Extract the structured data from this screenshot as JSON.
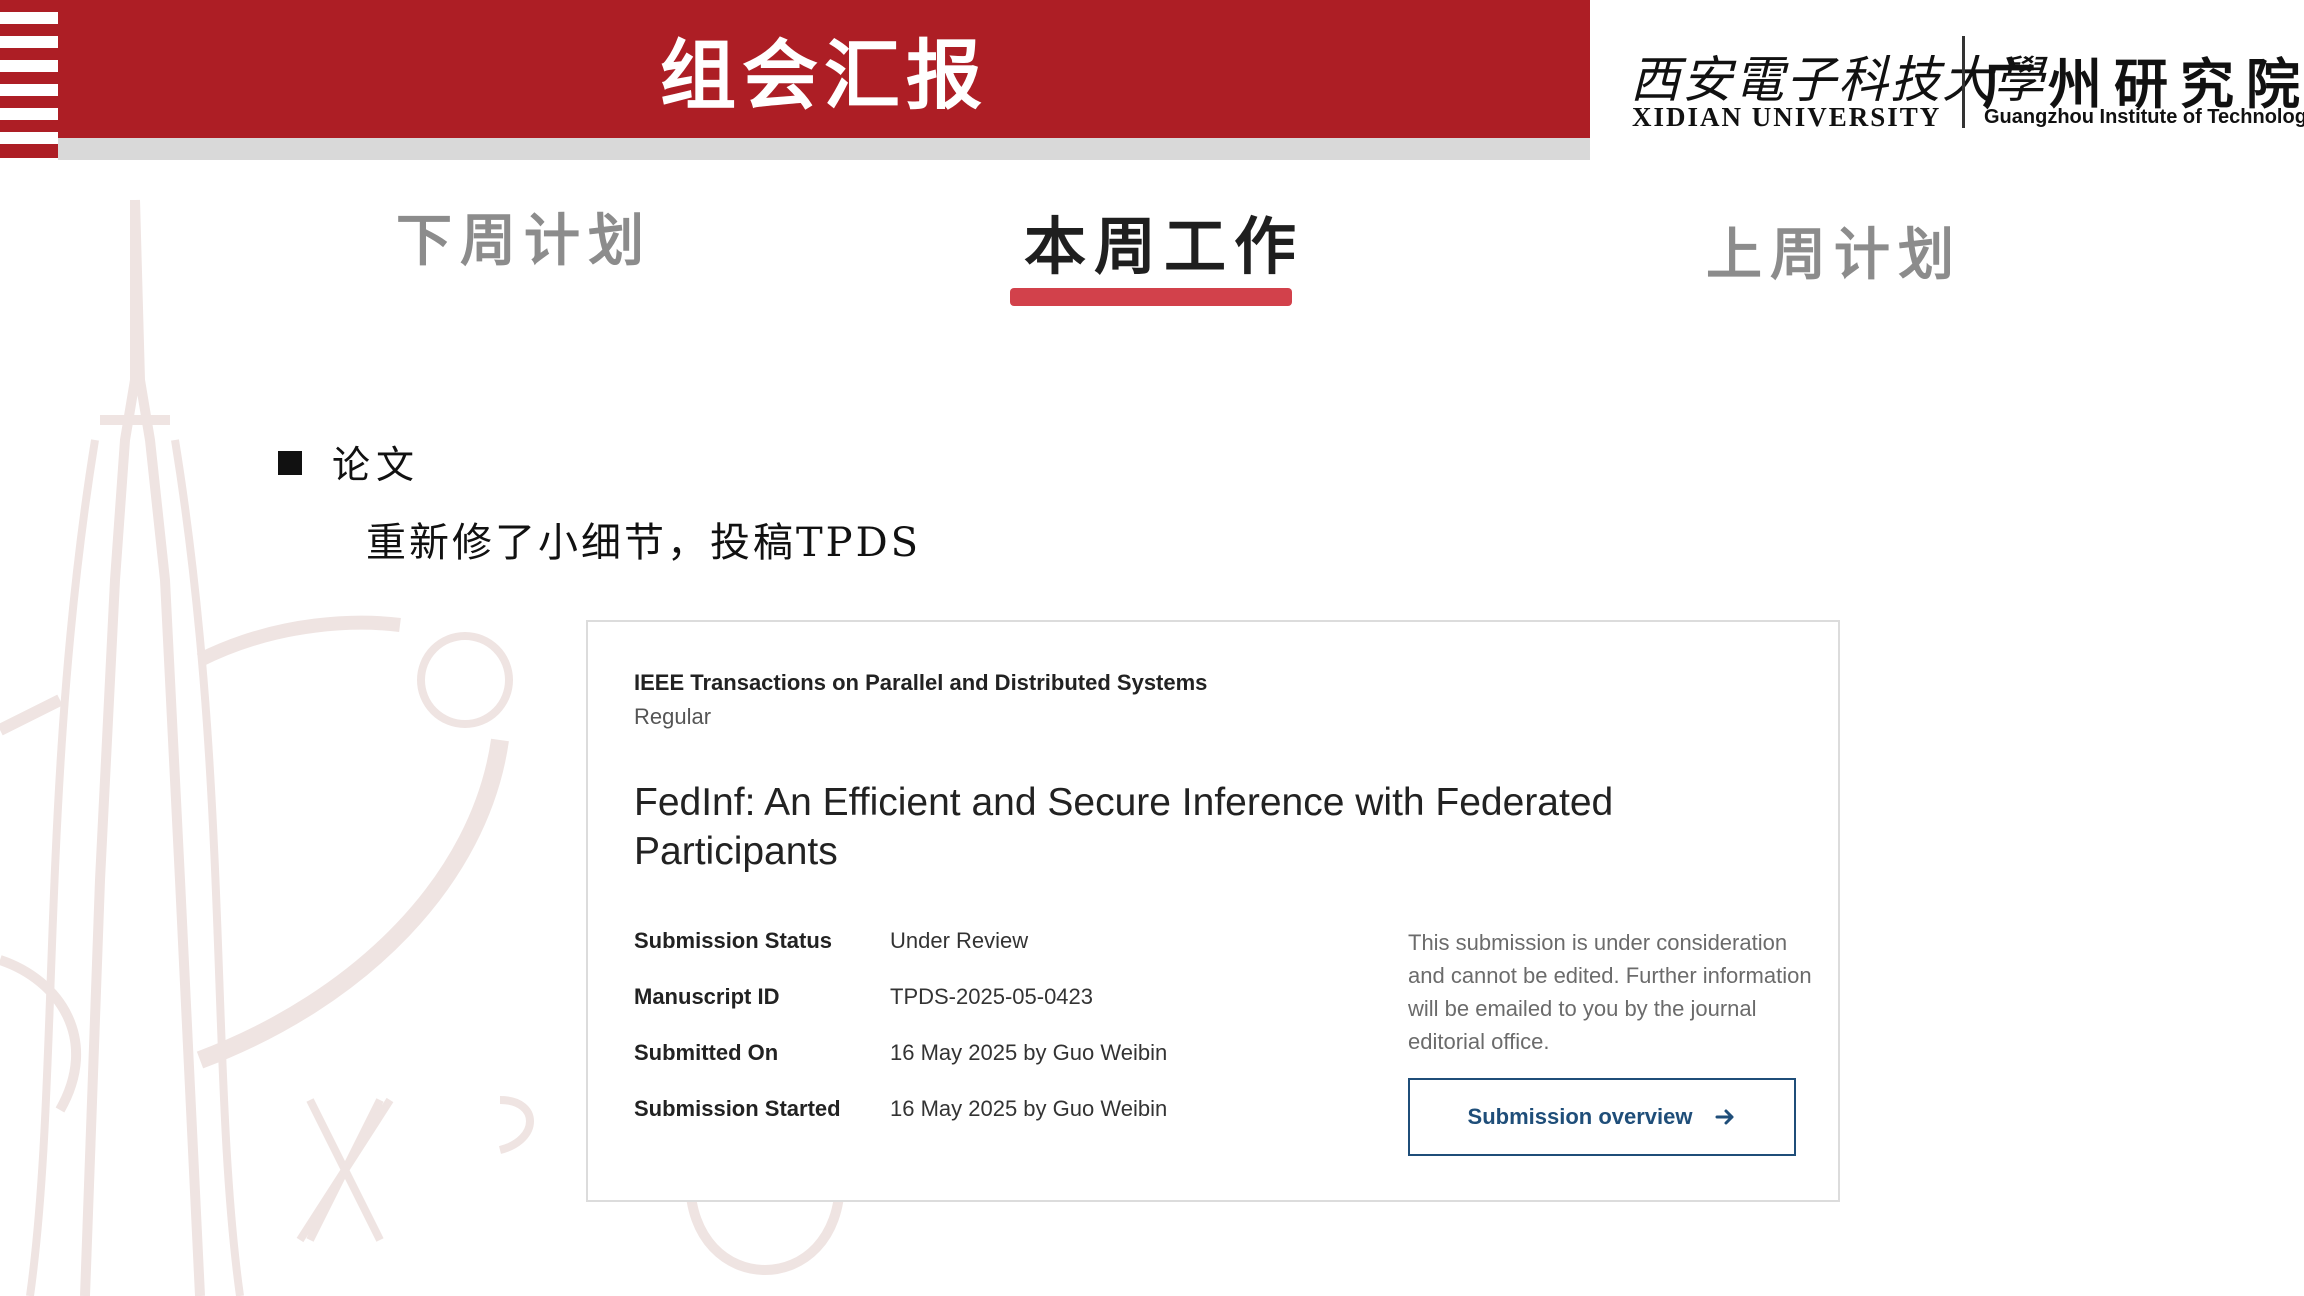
{
  "header": {
    "title": "组会汇报",
    "brand_color": "#AD1E25",
    "logos": {
      "xidian_cn": "西安電子科技大學",
      "xidian_en": "XIDIAN UNIVERSITY",
      "guangzhou_cn": "广州研究院",
      "guangzhou_en": "Guangzhou Institute of Technology"
    }
  },
  "tabs": [
    {
      "label": "下周计划",
      "active": false
    },
    {
      "label": "本周工作",
      "active": true
    },
    {
      "label": "上周计划",
      "active": false
    }
  ],
  "accent_color": "#D2414B",
  "content": {
    "bullet_label": "论文",
    "body": "重新修了小细节，投稿TPDS"
  },
  "submission": {
    "journal": "IEEE Transactions on Parallel and Distributed Systems",
    "type": "Regular",
    "title": "FedInf: An Efficient and Secure Inference with Federated Participants",
    "fields": [
      {
        "label": "Submission Status",
        "value": "Under Review"
      },
      {
        "label": "Manuscript ID",
        "value": "TPDS-2025-05-0423"
      },
      {
        "label": "Submitted On",
        "value": "16 May 2025 by Guo Weibin"
      },
      {
        "label": "Submission Started",
        "value": "16 May 2025 by Guo Weibin"
      }
    ],
    "notice": "This submission is under consideration and cannot be edited. Further information will be emailed to you by the journal editorial office.",
    "overview_button": "Submission overview",
    "button_icon": "arrow-right-icon",
    "button_color": "#1F4E79"
  }
}
